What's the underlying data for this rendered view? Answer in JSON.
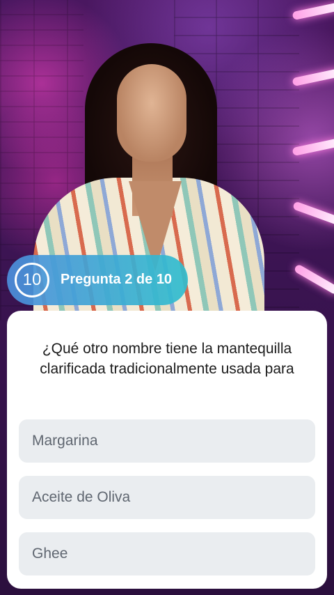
{
  "badge": {
    "timer_value": "10",
    "label": "Pregunta 2 de 10"
  },
  "question": {
    "text": "¿Qué otro nombre tiene la mantequilla clarificada tradicionalmente usada para"
  },
  "options": [
    {
      "label": "Margarina"
    },
    {
      "label": "Aceite de Oliva"
    },
    {
      "label": "Ghee"
    }
  ],
  "colors": {
    "badge_gradient_start": "#4d8edc",
    "badge_gradient_end": "#30bece",
    "card_background": "#ffffff",
    "option_background": "#eaedf0",
    "option_text": "#5f6670",
    "question_text": "#1b1b1b"
  }
}
